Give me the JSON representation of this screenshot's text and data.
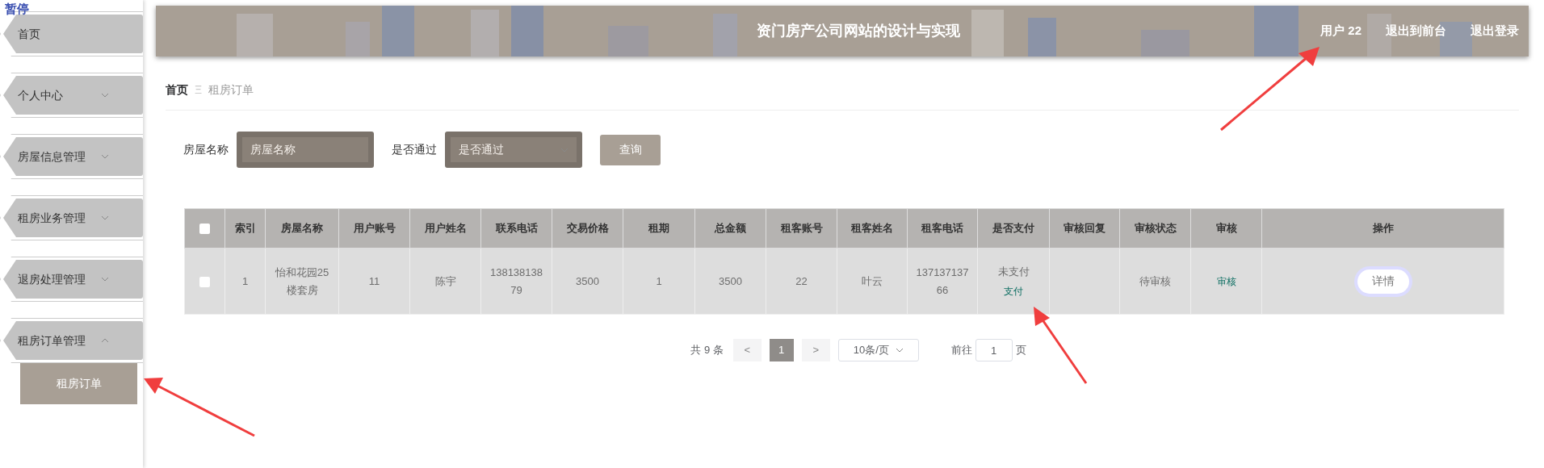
{
  "overlay_label": "暂停",
  "sidebar": {
    "items": [
      {
        "label": "首页",
        "has_children": false
      },
      {
        "label": "个人中心",
        "has_children": true,
        "expanded": false
      },
      {
        "label": "房屋信息管理",
        "has_children": true,
        "expanded": false
      },
      {
        "label": "租房业务管理",
        "has_children": true,
        "expanded": false
      },
      {
        "label": "退房处理管理",
        "has_children": true,
        "expanded": false
      },
      {
        "label": "租房订单管理",
        "has_children": true,
        "expanded": true,
        "children": [
          {
            "label": "租房订单",
            "selected": true
          }
        ]
      }
    ]
  },
  "header": {
    "title": "资门房产公司网站的设计与实现",
    "links": [
      "用户 22",
      "退出到前台",
      "退出登录"
    ]
  },
  "breadcrumb": {
    "items": [
      "首页",
      "租房订单"
    ],
    "separator": "Ξ"
  },
  "search": {
    "fields": [
      {
        "label": "房屋名称",
        "kind": "input",
        "placeholder": "房屋名称"
      },
      {
        "label": "是否通过",
        "kind": "select",
        "placeholder": "是否通过"
      }
    ],
    "button": "查询"
  },
  "table": {
    "header_checkbox": {
      "checked": false
    },
    "columns": [
      "索引",
      "房屋名称",
      "用户账号",
      "用户姓名",
      "联系电话",
      "交易价格",
      "租期",
      "总金额",
      "租客账号",
      "租客姓名",
      "租客电话",
      "是否支付",
      "审核回复",
      "审核状态",
      "审核",
      "操作"
    ],
    "rows": [
      {
        "checked": false,
        "cells": [
          "1",
          "怡和花园25楼套房",
          "11",
          "陈宇",
          "13813813879",
          "3500",
          "1",
          "3500",
          "22",
          "叶云",
          "13713713766"
        ],
        "pay_status": "未支付",
        "pay_link": "支付",
        "review_status": "待审核",
        "review_link": "审核",
        "action": "详情"
      }
    ]
  },
  "pagination": {
    "total": "共 9 条",
    "prev": "<",
    "pages": [
      {
        "label": "1",
        "selected": true
      }
    ],
    "next": ">",
    "page_size": "10条/页",
    "goto_label": "前往",
    "goto_value": "1",
    "goto_suffix": "页"
  }
}
